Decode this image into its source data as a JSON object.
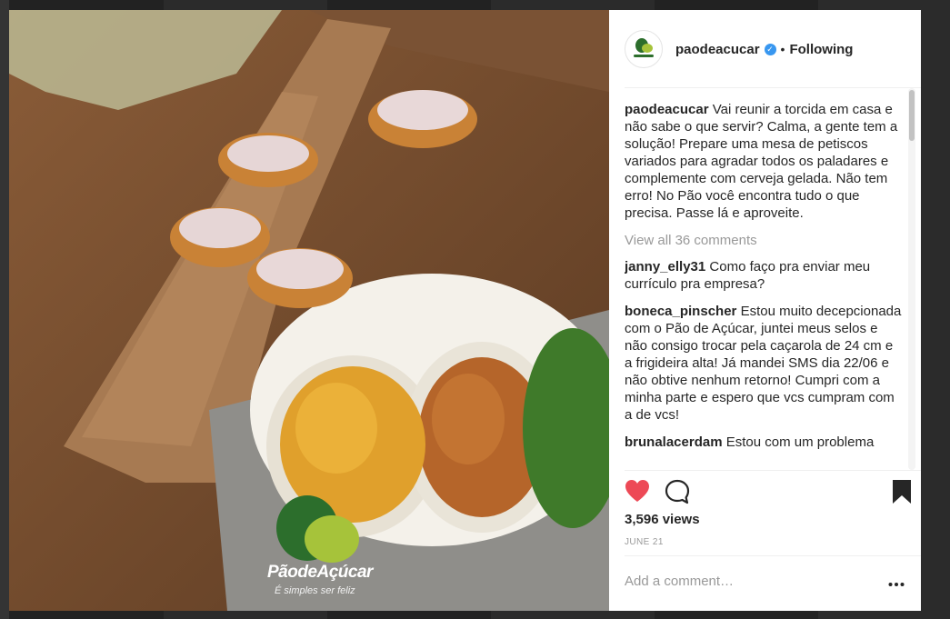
{
  "post": {
    "username": "paodeacucar",
    "follow_status": "Following",
    "separator": "•",
    "caption": "Vai reunir a torcida em casa e não sabe o que servir? Calma, a gente tem a solução! Prepare uma mesa de petiscos variados para agradar todos os paladares e complemente com cerveja gelada. Não tem erro! No Pão você encontra tudo o que precisa. Passe lá e aproveite.",
    "view_all_comments": "View all 36 comments",
    "comments": [
      {
        "user": "janny_elly31",
        "text": "Como faço pra enviar meu currículo pra empresa?"
      },
      {
        "user": "boneca_pinscher",
        "text": "Estou muito decepcionada com o Pão de Açúcar, juntei meus selos e não consigo trocar pela caçarola de 24 cm e a frigideira alta! Já mandei SMS dia 22/06 e não obtive nenhum retorno! Cumpri com a minha parte e espero que vcs cumpram com a de vcs!"
      },
      {
        "user": "brunalacerdam",
        "text": "Estou com um problema"
      }
    ],
    "views": "3,596 views",
    "date": "JUNE 21",
    "add_comment_placeholder": "Add a comment…"
  },
  "image": {
    "brand_name": "PãodeAçúcar",
    "brand_tagline": "É simples ser feliz",
    "avatar_brand": "PãoAçúcar"
  },
  "colors": {
    "like": "#ed4956",
    "verified": "#3897f0",
    "brand_dark_green": "#2c6e2c",
    "brand_light_green": "#a6c33a"
  },
  "icons": {
    "like": "heart-icon",
    "comment": "comment-icon",
    "save": "bookmark-icon",
    "more": "more-options-icon",
    "verified": "verified-badge-icon"
  }
}
